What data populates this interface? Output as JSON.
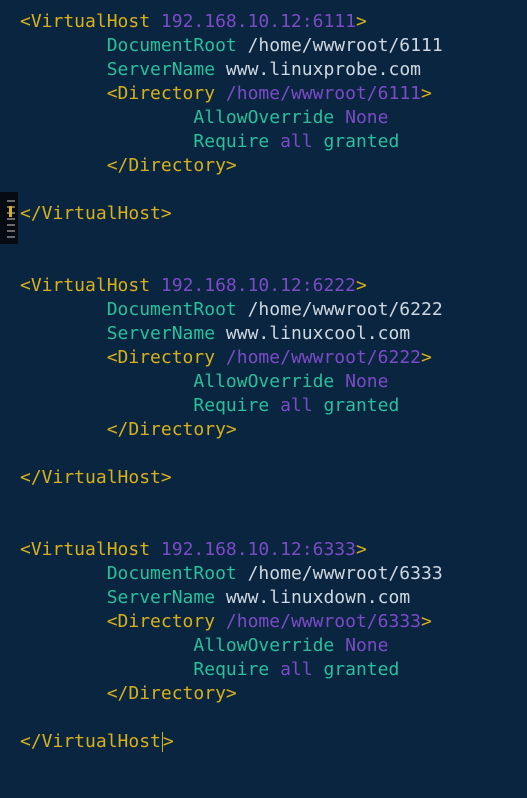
{
  "editor": {
    "colors": {
      "background": "#0a2540",
      "tag": "#d8b11a",
      "directive": "#2bbf9c",
      "string": "#cfd8e0",
      "value": "#7b4bc7"
    },
    "blocks": [
      {
        "open_tag": "<VirtualHost",
        "ip": "192.168.10.12:6111",
        "open_end": ">",
        "document_root_key": "DocumentRoot",
        "document_root": "/home/wwwroot/6111",
        "server_name_key": "ServerName",
        "server_name": "www.linuxprobe.com",
        "dir_open": "<Directory",
        "dir_path": "/home/wwwroot/6111",
        "dir_open_end": ">",
        "allow_key": "AllowOverride",
        "allow_value": "None",
        "require_key": "Require",
        "require_all": "all",
        "require_granted": "granted",
        "dir_close": "</Directory>",
        "close_tag": "</VirtualHost>"
      },
      {
        "open_tag": "<VirtualHost",
        "ip": "192.168.10.12:6222",
        "open_end": ">",
        "document_root_key": "DocumentRoot",
        "document_root": "/home/wwwroot/6222",
        "server_name_key": "ServerName",
        "server_name": "www.linuxcool.com",
        "dir_open": "<Directory",
        "dir_path": "/home/wwwroot/6222",
        "dir_open_end": ">",
        "allow_key": "AllowOverride",
        "allow_value": "None",
        "require_key": "Require",
        "require_all": "all",
        "require_granted": "granted",
        "dir_close": "</Directory>",
        "close_tag": "</VirtualHost>"
      },
      {
        "open_tag": "<VirtualHost",
        "ip": "192.168.10.12:6333",
        "open_end": ">",
        "document_root_key": "DocumentRoot",
        "document_root": "/home/wwwroot/6333",
        "server_name_key": "ServerName",
        "server_name": "www.linuxdown.com",
        "dir_open": "<Directory",
        "dir_path": "/home/wwwroot/6333",
        "dir_open_end": ">",
        "allow_key": "AllowOverride",
        "allow_value": "None",
        "require_key": "Require",
        "require_all": "all",
        "require_granted": "granted",
        "dir_close": "</Directory>",
        "close_tag_prefix": "</VirtualHost",
        "close_tag_end": ">"
      }
    ]
  }
}
